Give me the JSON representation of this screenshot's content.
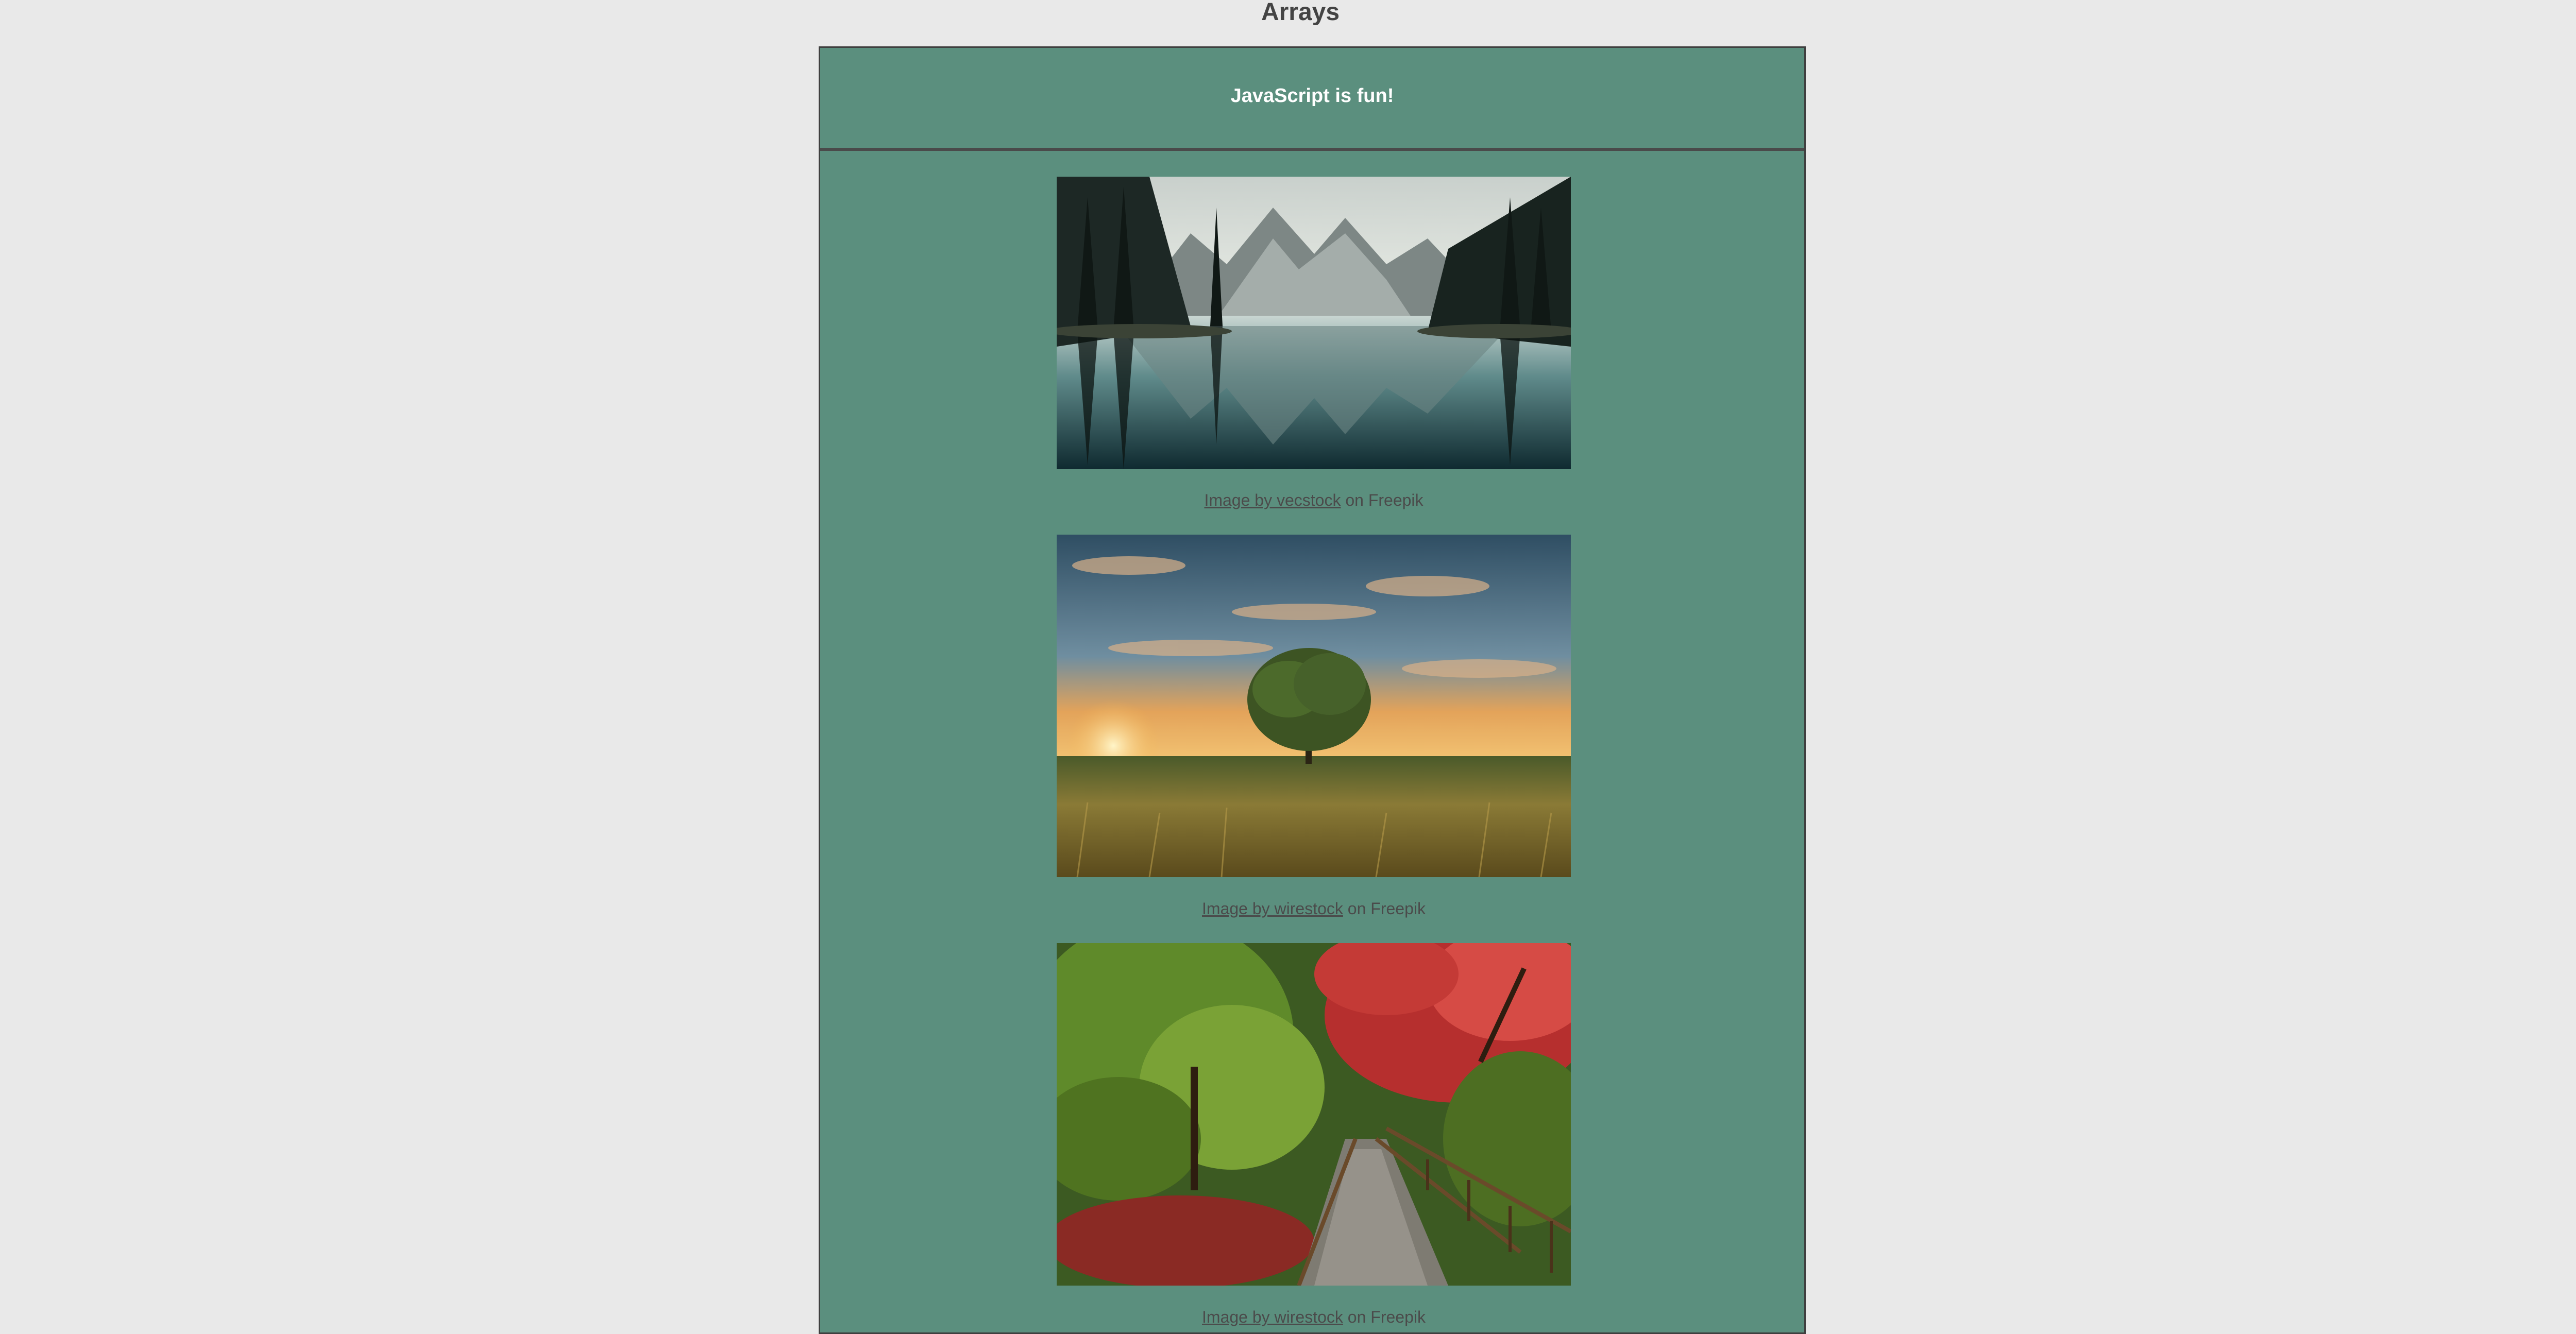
{
  "page": {
    "title": "Arrays"
  },
  "banner": {
    "text": "JavaScript is fun!"
  },
  "gallery": [
    {
      "image_alt": "Mountain lake reflection with pine trees",
      "credit_link": "Image by vecstock",
      "credit_suffix": " on Freepik"
    },
    {
      "image_alt": "Lone tree in a golden field at sunset",
      "credit_link": "Image by wirestock",
      "credit_suffix": " on Freepik"
    },
    {
      "image_alt": "Garden path with red and green autumn trees",
      "credit_link": "Image by wirestock",
      "credit_suffix": " on Freepik"
    }
  ],
  "colors": {
    "background": "#e9e9e9",
    "panel": "#5b8f7e",
    "border": "#3f3f3f",
    "banner_text": "#ffffff",
    "caption_text": "#4b4b4b"
  }
}
